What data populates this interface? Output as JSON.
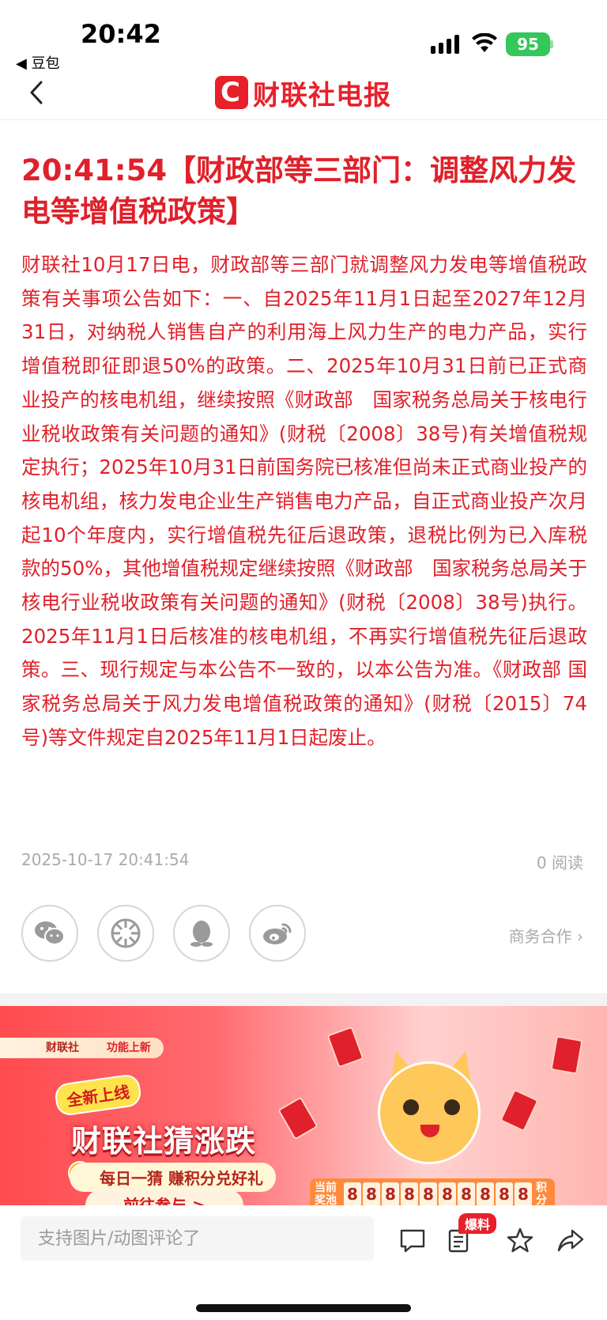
{
  "status_bar": {
    "time": "20:42",
    "back_app": "◀ 豆包",
    "battery": "95"
  },
  "nav": {
    "logo_mark": "C",
    "logo_text_a": "财联社",
    "logo_text_b": "电报",
    "brand_color": "#e8202a"
  },
  "article": {
    "headline": "20:41:54【财政部等三部门：调整风力发电等增值税政策】",
    "body": "财联社10月17日电，财政部等三部门就调整风力发电等增值税政策有关事项公告如下：一、自2025年11月1日起至2027年12月31日，对纳税人销售自产的利用海上风力生产的电力产品，实行增值税即征即退50%的政策。二、2025年10月31日前已正式商业投产的核电机组，继续按照《财政部　国家税务总局关于核电行业税收政策有关问题的通知》(财税〔2008〕38号)有关增值税规定执行；2025年10月31日前国务院已核准但尚未正式商业投产的核电机组，核力发电企业生产销售电力产品，自正式商业投产次月起10个年度内，实行增值税先征后退政策，退税比例为已入库税款的50%，其他增值税规定继续按照《财政部　国家税务总局关于核电行业税收政策有关问题的通知》(财税〔2008〕38号)执行。2025年11月1日后核准的核电机组，不再实行增值税先征后退政策。三、现行规定与本公告不一致的，以本公告为准。《财政部 国家税务总局关于风力发电增值税政策的通知》(财税〔2015〕74号)等文件规定自2025年11月1日起废止。",
    "date": "2025-10-17 20:41:54",
    "read_count": "0 阅读",
    "text_color": "#e0202a"
  },
  "share": {
    "icons": [
      "wechat-icon",
      "moments-icon",
      "qq-icon",
      "weibo-icon"
    ],
    "biz_link": "商务合作 ›"
  },
  "banner": {
    "tag_brand": "财联社",
    "tag_text": "功能上新",
    "new_label": "全新上线",
    "title": "财联社猜涨跌",
    "subtitle": "每日一猜 赚积分兑好礼",
    "button": "前往参与 >",
    "counter_label": "当前奖池",
    "counter_digits": [
      "8",
      "8",
      "8",
      "8",
      "8",
      "8",
      "8",
      "8",
      "8",
      "8"
    ],
    "counter_suffix": "积分"
  },
  "bottom_bar": {
    "comment_placeholder": "支持图片/动图评论了",
    "badge": "爆料",
    "icons": [
      "comment-icon",
      "report-icon",
      "star-icon",
      "share-icon"
    ]
  }
}
